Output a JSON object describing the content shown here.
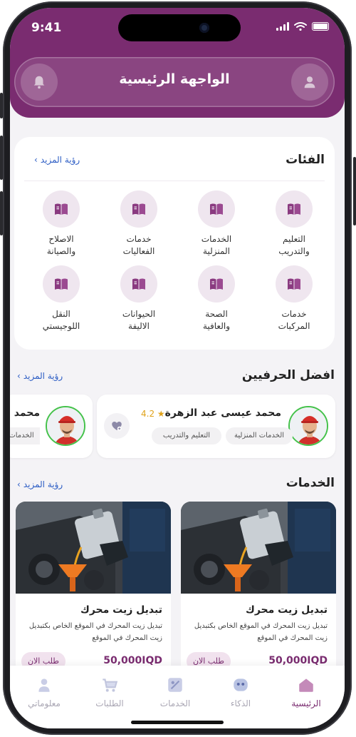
{
  "colors": {
    "primary": "#7a2c70",
    "accent_link": "#2b5cc4",
    "rating": "#e0a21a",
    "avatar_ring": "#44c24a"
  },
  "status_bar": {
    "time": "9:41"
  },
  "header": {
    "title": "الواجهة الرئيسية",
    "left_icon": "bell-icon",
    "right_icon": "user-icon"
  },
  "categories": {
    "title": "الفئات",
    "see_more": "رؤية المزيد",
    "items": [
      {
        "line1": "التعليم",
        "line2": "والتدريب",
        "icon": "book-icon"
      },
      {
        "line1": "الخدمات",
        "line2": "المنزلية",
        "icon": "book-icon"
      },
      {
        "line1": "خدمات",
        "line2": "الفعاليات",
        "icon": "book-icon"
      },
      {
        "line1": "الاصلاح",
        "line2": "والصيانة",
        "icon": "book-icon"
      },
      {
        "line1": "خدمات",
        "line2": "المركبات",
        "icon": "book-icon"
      },
      {
        "line1": "الصحة",
        "line2": "والعافية",
        "icon": "book-icon"
      },
      {
        "line1": "الحيوانات",
        "line2": "الاليفة",
        "icon": "book-icon"
      },
      {
        "line1": "النقل",
        "line2": "اللوجيستي",
        "icon": "book-icon"
      }
    ]
  },
  "artisans": {
    "title": "افضل الحرفيين",
    "see_more": "رؤية المزيد",
    "items": [
      {
        "name": "محمد عيسى عبد الزهرة",
        "rating": "4.2",
        "tags": [
          "الخدمات المنزلية",
          "التعليم والتدريب"
        ]
      },
      {
        "name": "محمد",
        "tags": [
          "الخدمات"
        ]
      }
    ]
  },
  "services": {
    "title": "الخدمات",
    "see_more": "رؤية المزيد",
    "items": [
      {
        "name": "تبديل زيت محرك",
        "desc": "تبديل زيت المحرك في الموقع الخاص بكتبديل زيت المحرك في الموقع",
        "price": "50,000IQD",
        "order": "طلب الان"
      },
      {
        "name": "تبديل زيت محرك",
        "desc": "تبديل زيت المحرك في الموقع الخاص بكتبديل زيت المحرك في الموقع",
        "price": "50,000IQD",
        "order": "طلب الان"
      }
    ]
  },
  "bottom_nav": {
    "items": [
      {
        "label": "الرئيسية",
        "icon": "home-icon",
        "active": true
      },
      {
        "label": "الذكاء",
        "icon": "ai-bot-icon"
      },
      {
        "label": "الخدمات",
        "icon": "services-icon"
      },
      {
        "label": "الطلبات",
        "icon": "cart-icon"
      },
      {
        "label": "معلوماتي",
        "icon": "profile-icon"
      }
    ]
  }
}
